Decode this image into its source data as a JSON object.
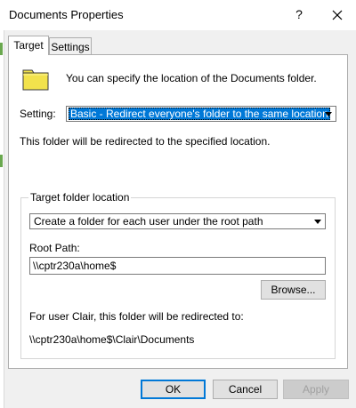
{
  "window": {
    "title": "Documents Properties",
    "help_glyph": "?"
  },
  "tabs": [
    {
      "label": "Target",
      "active": true
    },
    {
      "label": "Settings",
      "active": false
    }
  ],
  "target": {
    "intro_text": "You can specify the location of the Documents folder.",
    "setting_label": "Setting:",
    "setting_value": "Basic - Redirect everyone's folder to the same location",
    "redirect_note": "This folder will be redirected to the specified location.",
    "group": {
      "label": "Target folder location",
      "location_value": "Create a folder for each user under the root path",
      "root_path_label": "Root Path:",
      "root_path_value": "\\\\cptr230a\\home$",
      "browse_label": "Browse...",
      "example_text": "For user Clair, this folder will be redirected to:",
      "example_path": "\\\\cptr230a\\home$\\Clair\\Documents"
    }
  },
  "buttons": {
    "ok": "OK",
    "cancel": "Cancel",
    "apply": "Apply"
  },
  "colors": {
    "accent": "#0078d7",
    "folder_fill": "#f2e24c",
    "folder_outline": "#3a3a3a"
  }
}
